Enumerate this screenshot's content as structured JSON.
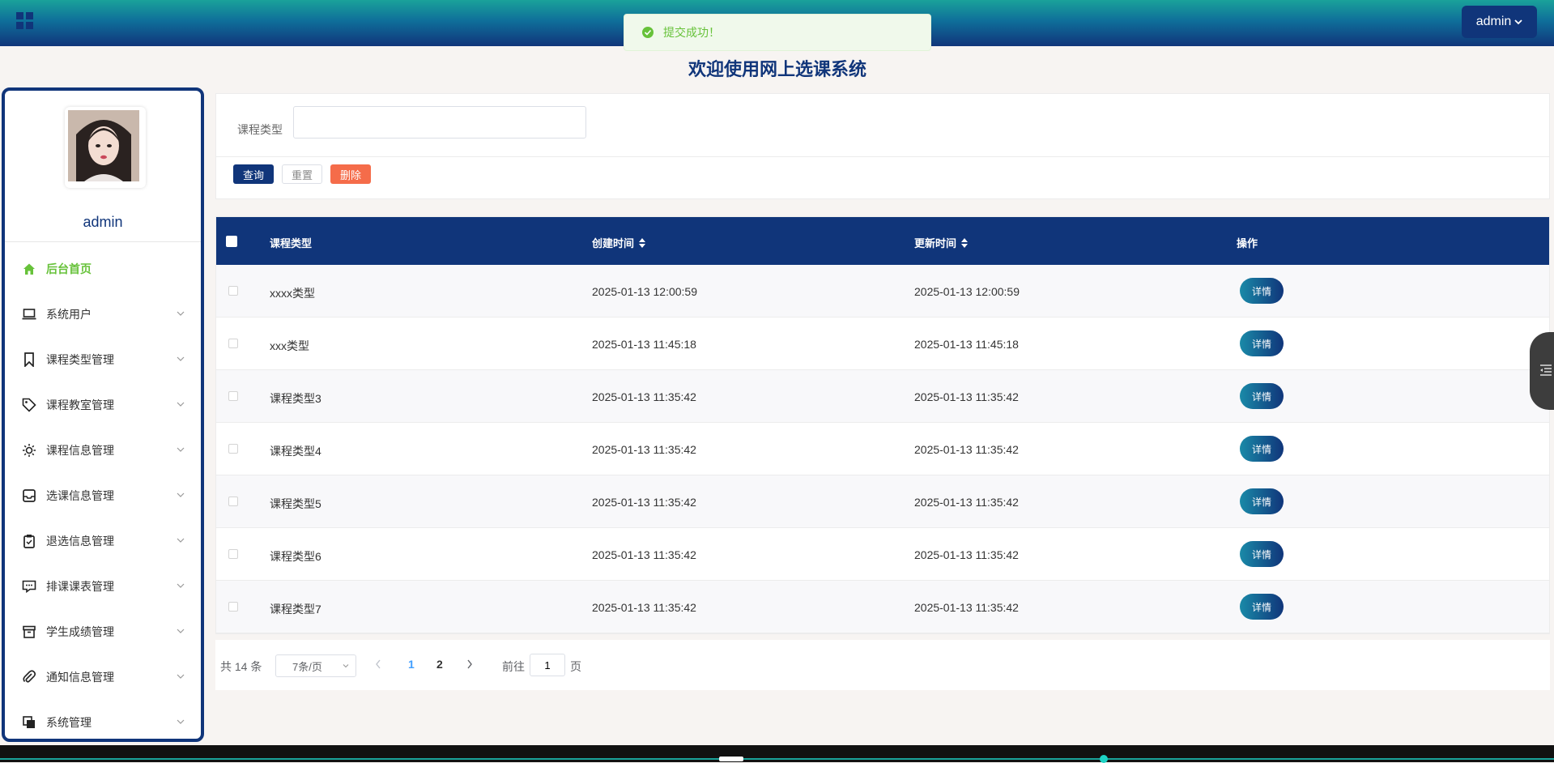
{
  "header": {
    "user_label": "admin",
    "toast_message": "提交成功！",
    "page_title": "欢迎使用网上选课系统"
  },
  "sidebar": {
    "username": "admin",
    "items": [
      {
        "label": "后台首页",
        "icon": "home-icon",
        "active": true
      },
      {
        "label": "系统用户",
        "icon": "laptop-icon"
      },
      {
        "label": "课程类型管理",
        "icon": "bookmark-icon"
      },
      {
        "label": "课程教室管理",
        "icon": "tag-icon"
      },
      {
        "label": "课程信息管理",
        "icon": "sun-icon"
      },
      {
        "label": "选课信息管理",
        "icon": "inbox-icon"
      },
      {
        "label": "退选信息管理",
        "icon": "clipboard-icon"
      },
      {
        "label": "排课课表管理",
        "icon": "message-icon"
      },
      {
        "label": "学生成绩管理",
        "icon": "archive-icon"
      },
      {
        "label": "通知信息管理",
        "icon": "paperclip-icon"
      },
      {
        "label": "系统管理",
        "icon": "copy-icon"
      }
    ]
  },
  "search": {
    "label": "课程类型",
    "value": "",
    "query_label": "查询",
    "reset_label": "重置",
    "delete_label": "删除"
  },
  "table": {
    "headers": {
      "type": "课程类型",
      "created": "创建时间",
      "updated": "更新时间",
      "op": "操作"
    },
    "detail_label": "详情",
    "rows": [
      {
        "type": "xxxx类型",
        "created": "2025-01-13 12:00:59",
        "updated": "2025-01-13 12:00:59"
      },
      {
        "type": "xxx类型",
        "created": "2025-01-13 11:45:18",
        "updated": "2025-01-13 11:45:18"
      },
      {
        "type": "课程类型3",
        "created": "2025-01-13 11:35:42",
        "updated": "2025-01-13 11:35:42"
      },
      {
        "type": "课程类型4",
        "created": "2025-01-13 11:35:42",
        "updated": "2025-01-13 11:35:42"
      },
      {
        "type": "课程类型5",
        "created": "2025-01-13 11:35:42",
        "updated": "2025-01-13 11:35:42"
      },
      {
        "type": "课程类型6",
        "created": "2025-01-13 11:35:42",
        "updated": "2025-01-13 11:35:42"
      },
      {
        "type": "课程类型7",
        "created": "2025-01-13 11:35:42",
        "updated": "2025-01-13 11:35:42"
      }
    ]
  },
  "pagination": {
    "total_text": "共 14 条",
    "page_size": "7条/页",
    "page_1": "1",
    "page_2": "2",
    "goto_label": "前往",
    "jump_value": "1",
    "page_suffix": "页"
  },
  "colors": {
    "primary": "#10357a",
    "success": "#67c23a",
    "danger": "#f56c4a",
    "link": "#409eff"
  }
}
